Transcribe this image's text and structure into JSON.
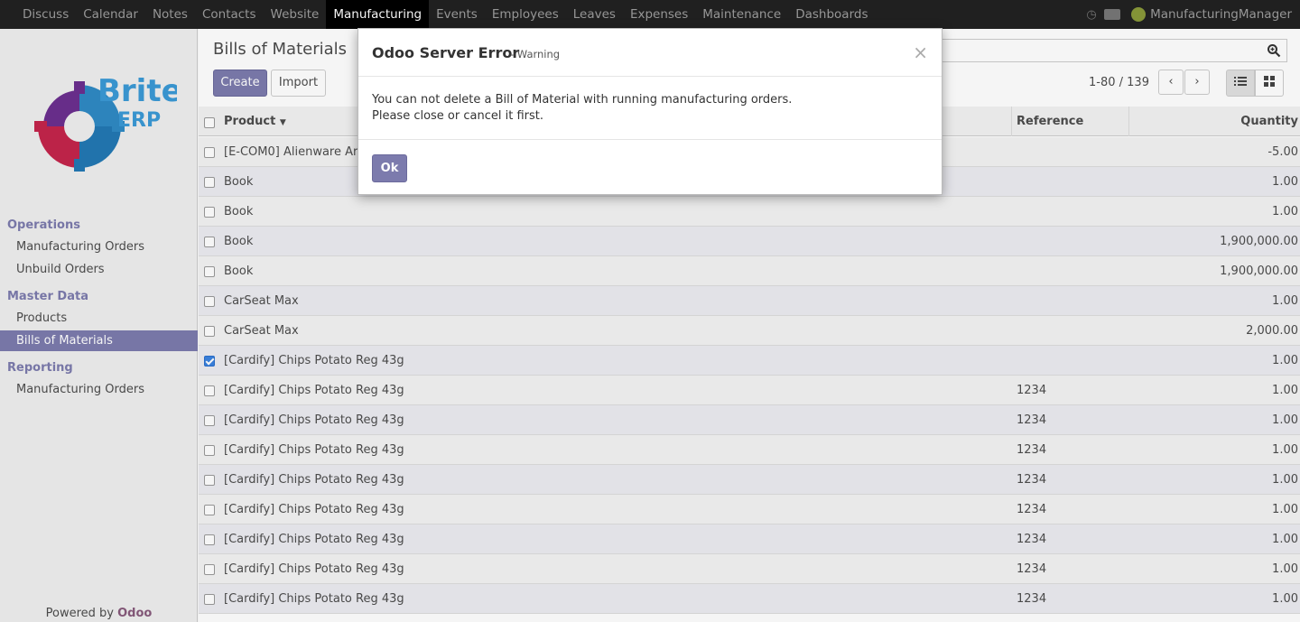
{
  "topbar": {
    "menu": [
      "Discuss",
      "Calendar",
      "Notes",
      "Contacts",
      "Website",
      "Manufacturing",
      "Events",
      "Employees",
      "Leaves",
      "Expenses",
      "Maintenance",
      "Dashboards"
    ],
    "active_menu": "Manufacturing",
    "user_name": "ManufacturingManager"
  },
  "sidebar": {
    "logo_text": "Brite ERP",
    "sections": [
      {
        "title": "Operations",
        "items": [
          "Manufacturing Orders",
          "Unbuild Orders"
        ]
      },
      {
        "title": "Master Data",
        "items": [
          "Products",
          "Bills of Materials"
        ]
      },
      {
        "title": "Reporting",
        "items": [
          "Manufacturing Orders"
        ]
      }
    ],
    "active_item": "Bills of Materials",
    "powered_by": "Powered by",
    "powered_brand": "Odoo"
  },
  "control": {
    "breadcrumb": "Bills of Materials",
    "create_label": "Create",
    "import_label": "Import",
    "pager": "1-80 / 139",
    "prev": "‹",
    "next": "›"
  },
  "list": {
    "headers": {
      "product": "Product",
      "reference": "Reference",
      "quantity": "Quantity"
    },
    "rows": [
      {
        "product": "[E-COM0] Alienware Are",
        "reference": "",
        "quantity": "-5.00",
        "checked": false
      },
      {
        "product": "Book",
        "reference": "",
        "quantity": "1.00",
        "checked": false
      },
      {
        "product": "Book",
        "reference": "",
        "quantity": "1.00",
        "checked": false
      },
      {
        "product": "Book",
        "reference": "",
        "quantity": "1,900,000.00",
        "checked": false
      },
      {
        "product": "Book",
        "reference": "",
        "quantity": "1,900,000.00",
        "checked": false
      },
      {
        "product": "CarSeat Max",
        "reference": "",
        "quantity": "1.00",
        "checked": false
      },
      {
        "product": "CarSeat Max",
        "reference": "",
        "quantity": "2,000.00",
        "checked": false
      },
      {
        "product": "[Cardify] Chips Potato Reg 43g",
        "reference": "",
        "quantity": "1.00",
        "checked": true
      },
      {
        "product": "[Cardify] Chips Potato Reg 43g",
        "reference": "1234",
        "quantity": "1.00",
        "checked": false
      },
      {
        "product": "[Cardify] Chips Potato Reg 43g",
        "reference": "1234",
        "quantity": "1.00",
        "checked": false
      },
      {
        "product": "[Cardify] Chips Potato Reg 43g",
        "reference": "1234",
        "quantity": "1.00",
        "checked": false
      },
      {
        "product": "[Cardify] Chips Potato Reg 43g",
        "reference": "1234",
        "quantity": "1.00",
        "checked": false
      },
      {
        "product": "[Cardify] Chips Potato Reg 43g",
        "reference": "1234",
        "quantity": "1.00",
        "checked": false
      },
      {
        "product": "[Cardify] Chips Potato Reg 43g",
        "reference": "1234",
        "quantity": "1.00",
        "checked": false
      },
      {
        "product": "[Cardify] Chips Potato Reg 43g",
        "reference": "1234",
        "quantity": "1.00",
        "checked": false
      },
      {
        "product": "[Cardify] Chips Potato Reg 43g",
        "reference": "1234",
        "quantity": "1.00",
        "checked": false
      }
    ]
  },
  "modal": {
    "title": "Odoo Server Error",
    "subtitle": "- Warning",
    "close": "×",
    "message_line1": "You can not delete a Bill of Material with running manufacturing orders.",
    "message_line2": "Please close or cancel it first.",
    "ok_label": "Ok"
  },
  "colors": {
    "accent": "#7c7bad",
    "topbar": "#222222",
    "brand": "#875a7b"
  }
}
